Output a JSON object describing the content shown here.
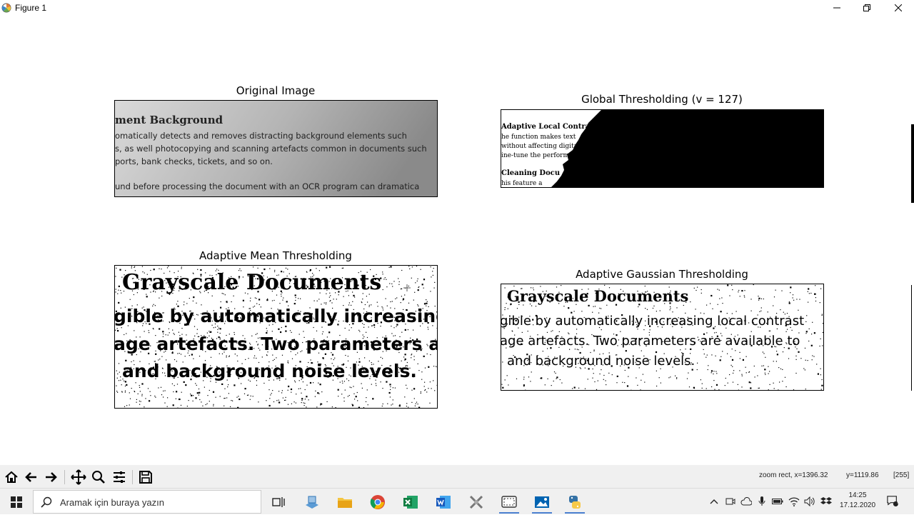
{
  "window": {
    "title": "Figure 1"
  },
  "figure": {
    "panels": [
      {
        "title": "Original Image",
        "lines": [
          "ment Background",
          "omatically  detects  and  removes  distracting  background  elements  such",
          "s, as well photocopying and scanning artefacts common in documents such",
          "ports, bank checks, tickets, and so on.",
          "und before processing the document with an OCR program can dramatica"
        ]
      },
      {
        "title": "Global Thresholding (v = 127)",
        "lines": [
          "Adaptive Local Contrast",
          "he function makes text",
          "without affecting digital",
          "ine-tune the perform",
          "Cleaning Docu",
          "his  feature  a"
        ]
      },
      {
        "title": "Adaptive Mean Thresholding",
        "lines": [
          "Grayscale Documents",
          "gible by automatically increasing lo",
          "age artefacts. Two parameters are",
          "and background noise levels."
        ]
      },
      {
        "title": "Adaptive Gaussian Thresholding",
        "lines": [
          "Grayscale Documents",
          "gible by automatically increasing local contrast",
          "age artefacts. Two parameters are available to",
          "and background noise levels."
        ]
      }
    ]
  },
  "toolbar": {
    "buttons": [
      "home-icon",
      "back-arrow-icon",
      "forward-arrow-icon",
      "pan-icon",
      "zoom-icon",
      "configure-subplots-icon",
      "save-icon"
    ],
    "status_mode": "zoom rect, x=1396.32",
    "status_y": "y=1119.86",
    "status_value": "[255]"
  },
  "taskbar": {
    "search_placeholder": "Aramak için buraya yazın",
    "time": "14:25",
    "date": "17.12.2020",
    "notification_count": "1"
  }
}
